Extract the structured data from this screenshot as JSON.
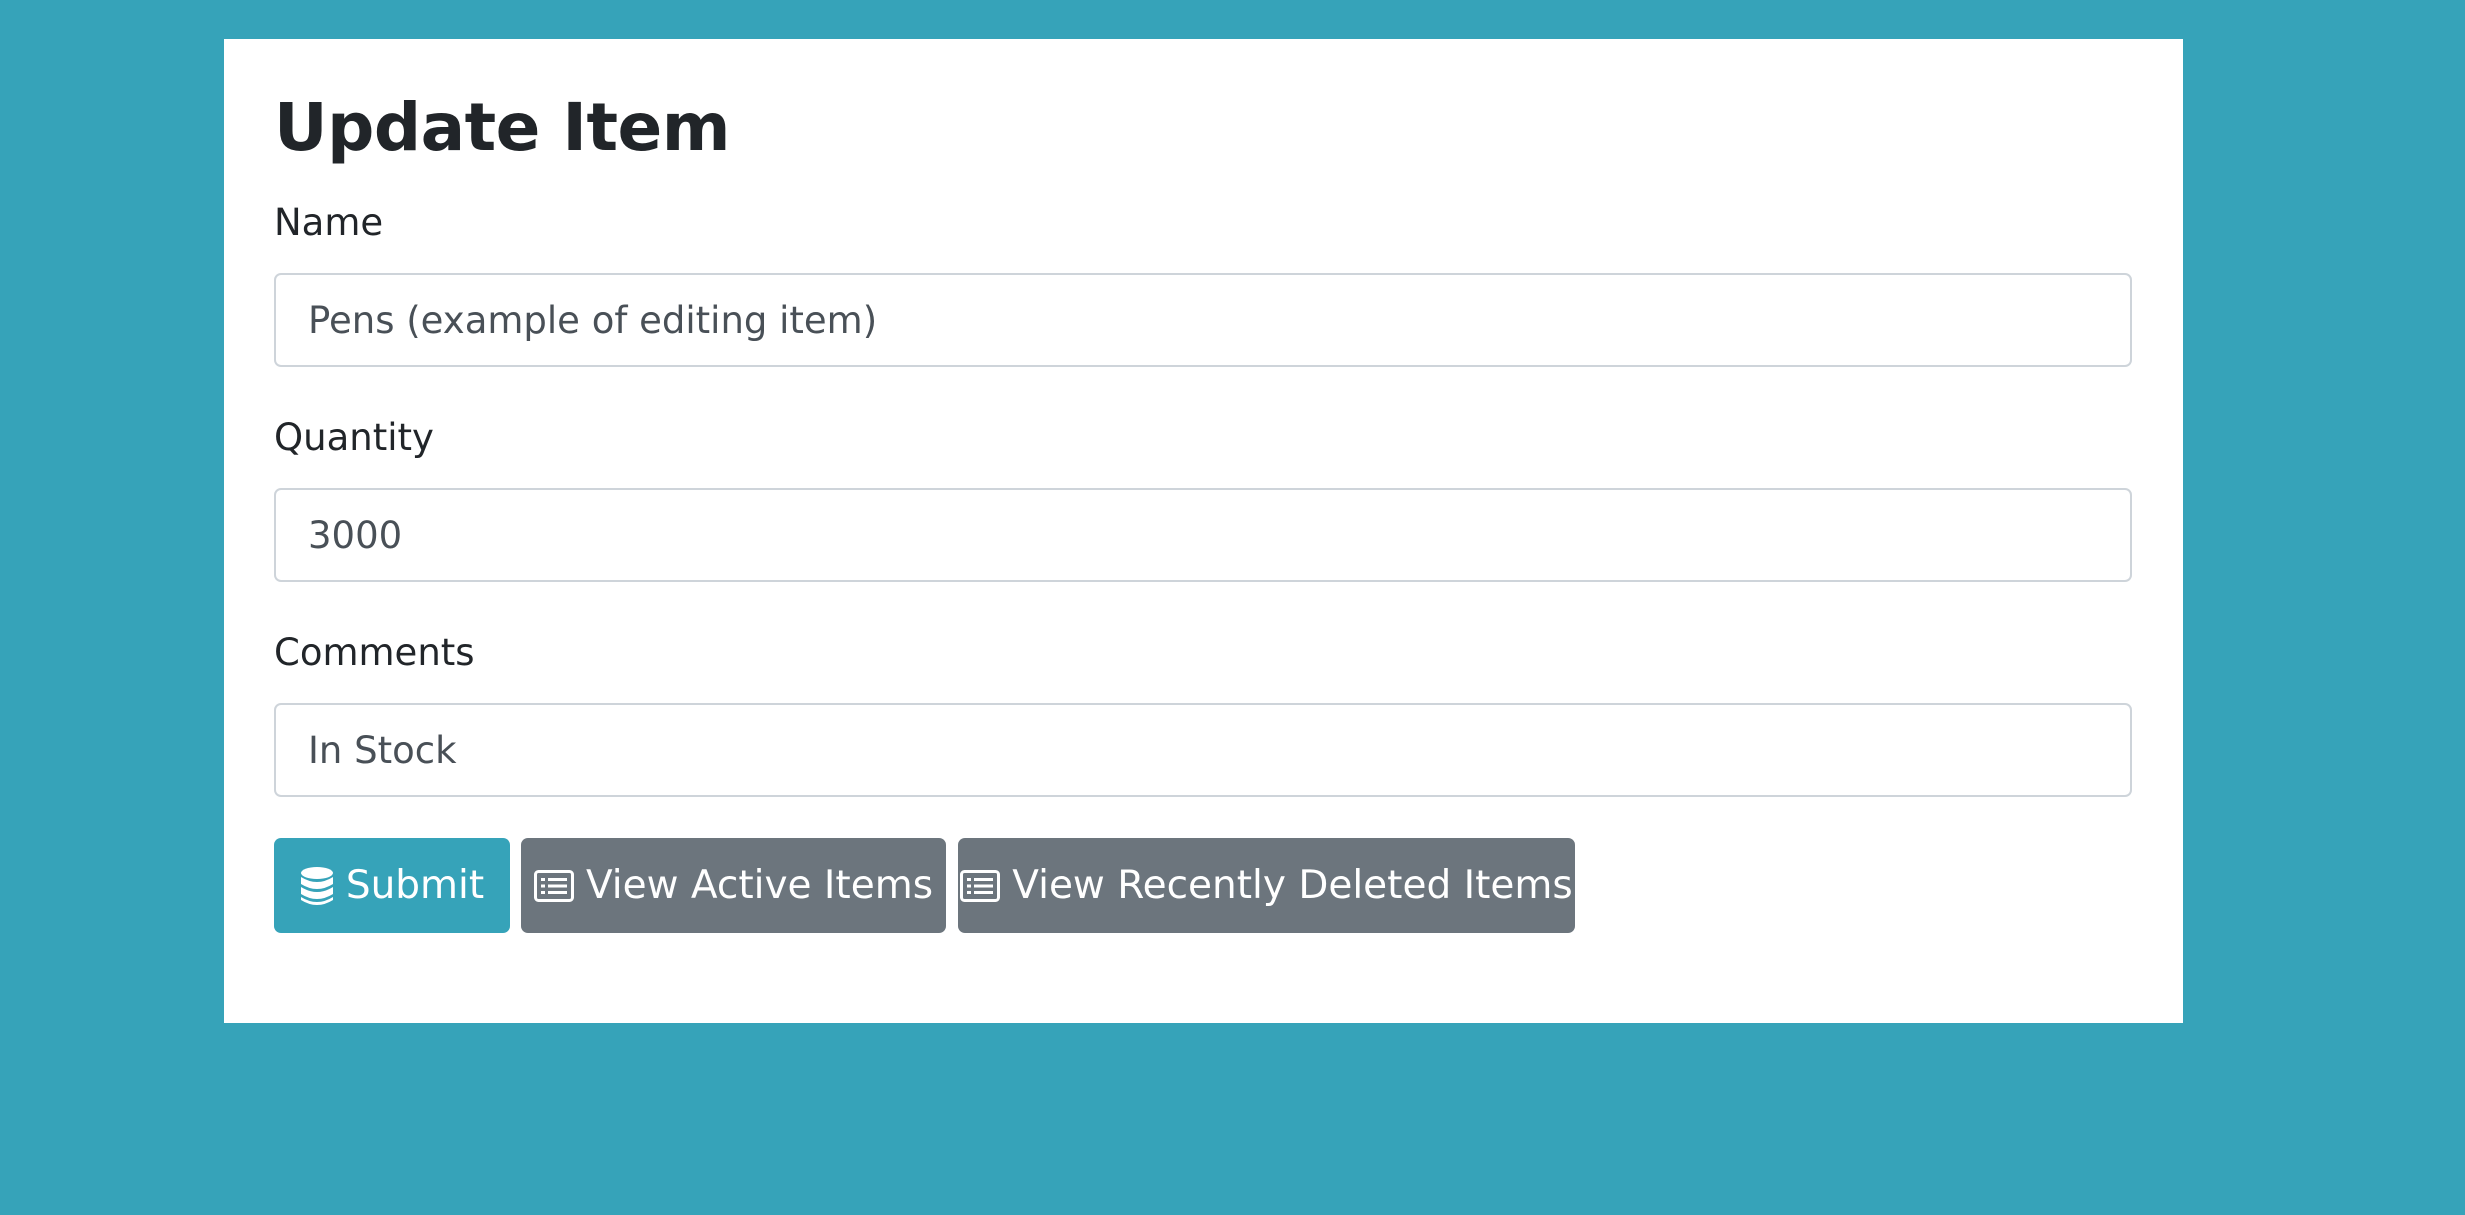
{
  "form": {
    "title": "Update Item",
    "name_label": "Name",
    "name_value": "Pens (example of editing item)",
    "quantity_label": "Quantity",
    "quantity_value": "3000",
    "comments_label": "Comments",
    "comments_value": "In Stock"
  },
  "buttons": {
    "submit_label": "Submit",
    "submit_icon": "database-icon",
    "active_label": "View Active Items",
    "active_icon": "list-alt-icon",
    "deleted_label": "View Recently Deleted Items",
    "deleted_icon": "list-alt-icon"
  },
  "colors": {
    "background": "#36a3b9",
    "card": "#ffffff",
    "primary_button": "#36a3b9",
    "secondary_button": "#6c757d",
    "input_border": "#ced4da",
    "text": "#212529"
  }
}
